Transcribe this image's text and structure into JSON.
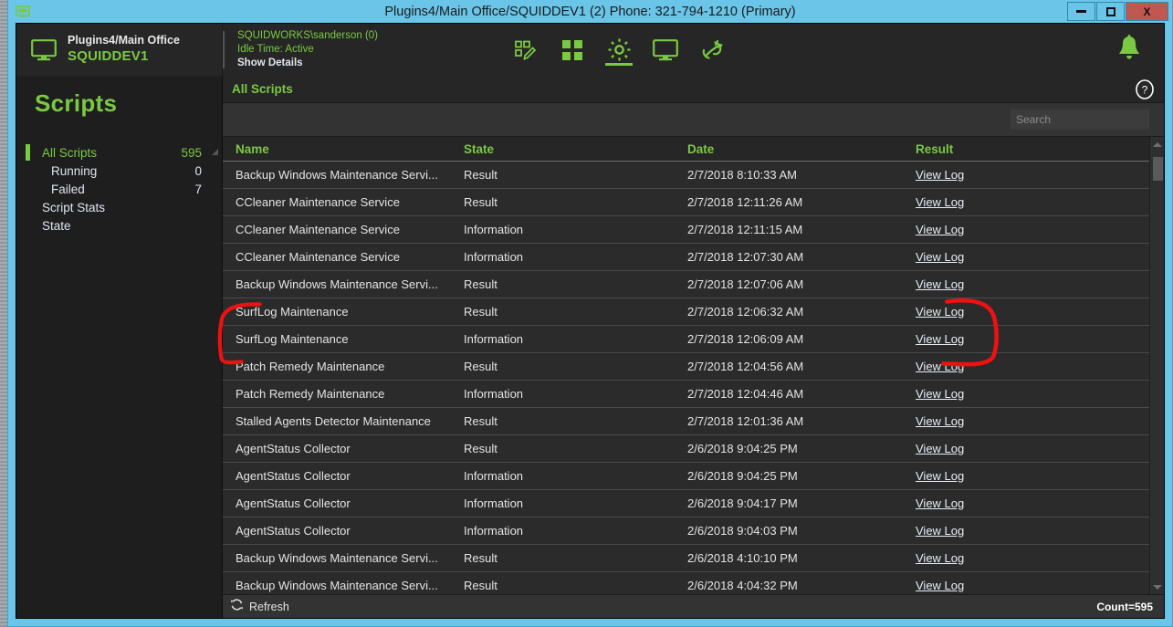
{
  "window": {
    "title": "Plugins4/Main Office/SQUIDDEV1 (2) Phone: 321-794-1210  (Primary)",
    "title_icon": "monitor-window-icon",
    "minimize_label": "",
    "maximize_label": "",
    "close_label": "X",
    "accent_blue": "#6ac5e8",
    "close_red": "#c0584f",
    "brand_green": "#7ac943"
  },
  "header": {
    "machine_icon": "monitor-icon",
    "machine_path": "Plugins4/Main Office",
    "machine_name": "SQUIDDEV1",
    "session_user": "SQUIDWORKS\\sanderson (0)",
    "idle_time": "Idle Time:  Active",
    "show_details": "Show Details",
    "toolbar": [
      {
        "name": "scripts-edit-icon",
        "active": false
      },
      {
        "name": "apps-grid-icon",
        "active": false
      },
      {
        "name": "gear-settings-icon",
        "active": true
      },
      {
        "name": "remote-screen-icon",
        "active": false
      },
      {
        "name": "plug-connect-icon",
        "active": false
      }
    ],
    "bell_icon": "notification-bell-icon"
  },
  "sidebar": {
    "title": "Scripts",
    "items": [
      {
        "label": "All Scripts",
        "count": "595",
        "selected": true,
        "indent": false
      },
      {
        "label": "Running",
        "count": "0",
        "selected": false,
        "indent": true
      },
      {
        "label": "Failed",
        "count": "7",
        "selected": false,
        "indent": true
      },
      {
        "label": "Script Stats",
        "count": "",
        "selected": false,
        "indent": false
      },
      {
        "label": "State",
        "count": "",
        "selected": false,
        "indent": false
      }
    ]
  },
  "content": {
    "title": "All Scripts",
    "help_icon": "help-question-icon",
    "search": {
      "value": "",
      "placeholder": "Search"
    },
    "columns": [
      "Name",
      "State",
      "Date",
      "Result"
    ],
    "rows": [
      {
        "name": "Backup Windows Maintenance Servi...",
        "state": "Result",
        "date": "2/7/2018 8:10:33 AM",
        "result": "View Log"
      },
      {
        "name": "CCleaner Maintenance Service",
        "state": "Result",
        "date": "2/7/2018 12:11:26 AM",
        "result": "View Log"
      },
      {
        "name": "CCleaner Maintenance Service",
        "state": "Information",
        "date": "2/7/2018 12:11:15 AM",
        "result": "View Log"
      },
      {
        "name": "CCleaner Maintenance Service",
        "state": "Information",
        "date": "2/7/2018 12:07:30 AM",
        "result": "View Log"
      },
      {
        "name": "Backup Windows Maintenance Servi...",
        "state": "Result",
        "date": "2/7/2018 12:07:06 AM",
        "result": "View Log"
      },
      {
        "name": "SurfLog Maintenance",
        "state": "Result",
        "date": "2/7/2018 12:06:32 AM",
        "result": "View Log"
      },
      {
        "name": "SurfLog Maintenance",
        "state": "Information",
        "date": "2/7/2018 12:06:09 AM",
        "result": "View Log"
      },
      {
        "name": "Patch Remedy Maintenance",
        "state": "Result",
        "date": "2/7/2018 12:04:56 AM",
        "result": "View Log"
      },
      {
        "name": "Patch Remedy Maintenance",
        "state": "Information",
        "date": "2/7/2018 12:04:46 AM",
        "result": "View Log"
      },
      {
        "name": "Stalled Agents Detector Maintenance",
        "state": "Result",
        "date": "2/7/2018 12:01:36 AM",
        "result": "View Log"
      },
      {
        "name": "AgentStatus Collector",
        "state": "Result",
        "date": "2/6/2018 9:04:25 PM",
        "result": "View Log"
      },
      {
        "name": "AgentStatus Collector",
        "state": "Information",
        "date": "2/6/2018 9:04:25 PM",
        "result": "View Log"
      },
      {
        "name": "AgentStatus Collector",
        "state": "Information",
        "date": "2/6/2018 9:04:17 PM",
        "result": "View Log"
      },
      {
        "name": "AgentStatus Collector",
        "state": "Information",
        "date": "2/6/2018 9:04:03 PM",
        "result": "View Log"
      },
      {
        "name": "Backup Windows Maintenance Servi...",
        "state": "Result",
        "date": "2/6/2018 4:10:10 PM",
        "result": "View Log"
      },
      {
        "name": "Backup Windows Maintenance Servi...",
        "state": "Result",
        "date": "2/6/2018 4:04:32 PM",
        "result": "View Log"
      }
    ]
  },
  "footer": {
    "refresh_icon": "refresh-icon",
    "refresh_label": "Refresh",
    "count_label": "Count=595"
  },
  "annotation": {
    "color": "#ee1111",
    "description": "red hand-drawn brackets around the two SurfLog Maintenance rows"
  }
}
